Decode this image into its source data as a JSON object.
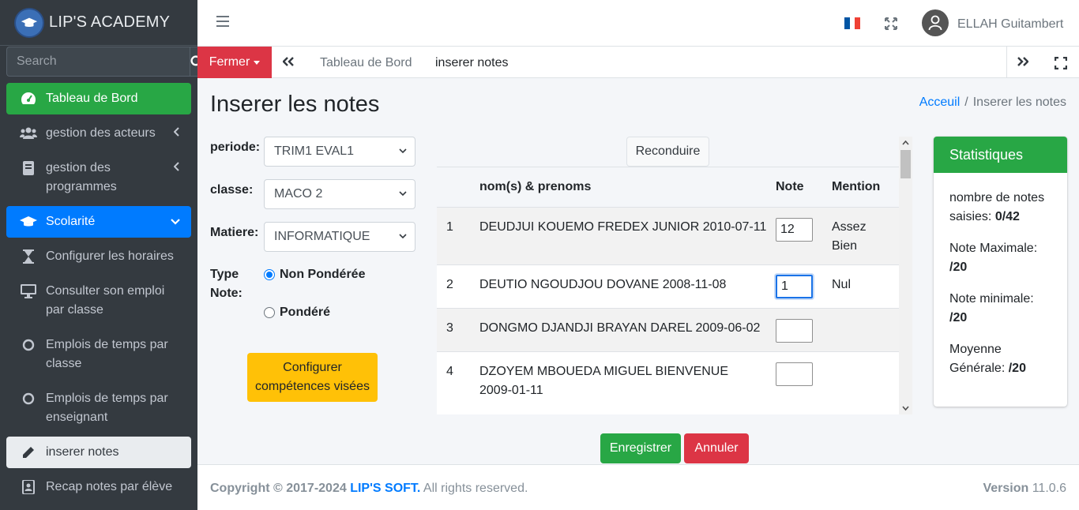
{
  "brand": {
    "name": "LIP'S ACADEMY"
  },
  "sidebar": {
    "search_placeholder": "Search",
    "items": [
      {
        "label": "Tableau de Bord",
        "icon": "dashboard-icon"
      },
      {
        "label": "gestion des acteurs",
        "icon": "users-icon"
      },
      {
        "label": "gestion des programmes",
        "icon": "book-icon"
      },
      {
        "label": "Scolarité",
        "icon": "graduation-cap-icon"
      },
      {
        "label": "Configurer les horaires",
        "icon": "hourglass-icon"
      },
      {
        "label": "Consulter son emploi par classe",
        "icon": "desktop-icon"
      },
      {
        "label": "Emplois de temps par classe",
        "icon": "circle-icon"
      },
      {
        "label": "Emplois de temps par enseignant",
        "icon": "circle-icon"
      },
      {
        "label": "inserer notes",
        "icon": "pencil-icon"
      },
      {
        "label": "Recap notes par élève",
        "icon": "id-card-icon"
      }
    ]
  },
  "header": {
    "user_name": "ELLAH Guitambert"
  },
  "tabbar": {
    "close_label": "Fermer",
    "tabs": [
      "Tableau de Bord",
      "inserer notes"
    ]
  },
  "page": {
    "title": "Inserer les notes",
    "breadcrumb": {
      "home": "Acceuil",
      "current": "Inserer les notes"
    }
  },
  "form": {
    "periode_label": "periode:",
    "periode_value": "TRIM1 EVAL1",
    "classe_label": "classe:",
    "classe_value": "MACO 2",
    "matiere_label": "Matiere:",
    "matiere_value": "INFORMATIQUE",
    "type_label_1": "Type",
    "type_label_2": "Note:",
    "option_1": "Non Pondérée",
    "option_2": "Pondéré",
    "config_button": "Configurer compétences visées"
  },
  "table": {
    "reconduire": "Reconduire",
    "headers": {
      "name": "nom(s) & prenoms",
      "note": "Note",
      "mention": "Mention"
    },
    "rows": [
      {
        "num": "1",
        "name": "DEUDJUI KOUEMO FREDEX JUNIOR 2010-07-11",
        "note": "12",
        "mention_1": "Assez",
        "mention_2": "Bien"
      },
      {
        "num": "2",
        "name": "DEUTIO NGOUDJOU DOVANE 2008-11-08",
        "note": "1",
        "mention_1": "Nul",
        "mention_2": ""
      },
      {
        "num": "3",
        "name": "DONGMO DJANDJI BRAYAN DAREL 2009-06-02",
        "note": "",
        "mention_1": "",
        "mention_2": ""
      },
      {
        "num": "4",
        "name_1": "DZOYEM MBOUEDA MIGUEL BIENVENUE",
        "name_2": "2009-01-11",
        "note": "",
        "mention_1": "",
        "mention_2": ""
      }
    ]
  },
  "actions": {
    "save": "Enregistrer",
    "cancel": "Annuler"
  },
  "stats": {
    "title": "Statistiques",
    "count_label_1": "nombre de notes",
    "count_label_2": "saisies:",
    "count_value": "0/42",
    "max_label": "Note Maximale:",
    "max_value": "/20",
    "min_label": "Note minimale:",
    "min_value": "/20",
    "avg_label_1": "Moyenne",
    "avg_label_2": "Générale:",
    "avg_value": "/20"
  },
  "footer": {
    "copyright": "Copyright © 2017-2024",
    "company": "LIP'S SOFT.",
    "rights": "All rights reserved.",
    "version_label": "Version",
    "version_value": "11.0.6"
  },
  "colors": {
    "accent_green": "#28a745",
    "accent_blue": "#007bff",
    "danger": "#dc3545",
    "warning": "#ffc107",
    "sidebar_bg": "#343a40"
  }
}
